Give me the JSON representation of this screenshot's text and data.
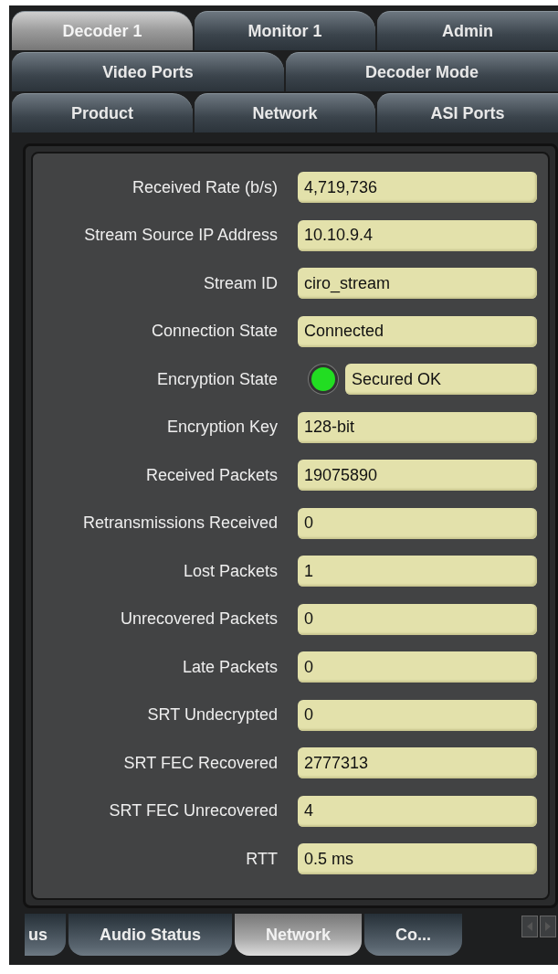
{
  "tab_rows": [
    [
      {
        "label": "Decoder 1",
        "selected": true
      },
      {
        "label": "Monitor 1",
        "selected": false
      },
      {
        "label": "Admin",
        "selected": false
      }
    ],
    [
      {
        "label": "Video Ports",
        "selected": false
      },
      {
        "label": "Decoder Mode",
        "selected": false
      }
    ],
    [
      {
        "label": "Product",
        "selected": false
      },
      {
        "label": "Network",
        "selected": false
      },
      {
        "label": "ASI Ports",
        "selected": false
      }
    ]
  ],
  "fields": [
    {
      "label": "Received Rate (b/s)",
      "value": "4,719,736"
    },
    {
      "label": "Stream Source IP Address",
      "value": "10.10.9.4"
    },
    {
      "label": "Stream ID",
      "value": "ciro_stream"
    },
    {
      "label": "Connection State",
      "value": "Connected"
    },
    {
      "label": "Encryption State",
      "value": "Secured OK",
      "color": "#22dd22"
    },
    {
      "label": "Encryption Key",
      "value": "128-bit"
    },
    {
      "label": "Received Packets",
      "value": "19075890"
    },
    {
      "label": "Retransmissions Received",
      "value": "0"
    },
    {
      "label": "Lost Packets",
      "value": "1"
    },
    {
      "label": "Unrecovered Packets",
      "value": "0"
    },
    {
      "label": "Late Packets",
      "value": "0"
    },
    {
      "label": "SRT Undecrypted",
      "value": "0"
    },
    {
      "label": "SRT FEC Recovered",
      "value": "2777313"
    },
    {
      "label": "SRT FEC Unrecovered",
      "value": "4"
    },
    {
      "label": "RTT",
      "value": "0.5 ms"
    }
  ],
  "bottom_tabs": [
    {
      "label": "us",
      "selected": false
    },
    {
      "label": "Audio Status",
      "selected": false
    },
    {
      "label": "Network",
      "selected": true
    },
    {
      "label": "Co...",
      "selected": false
    }
  ]
}
